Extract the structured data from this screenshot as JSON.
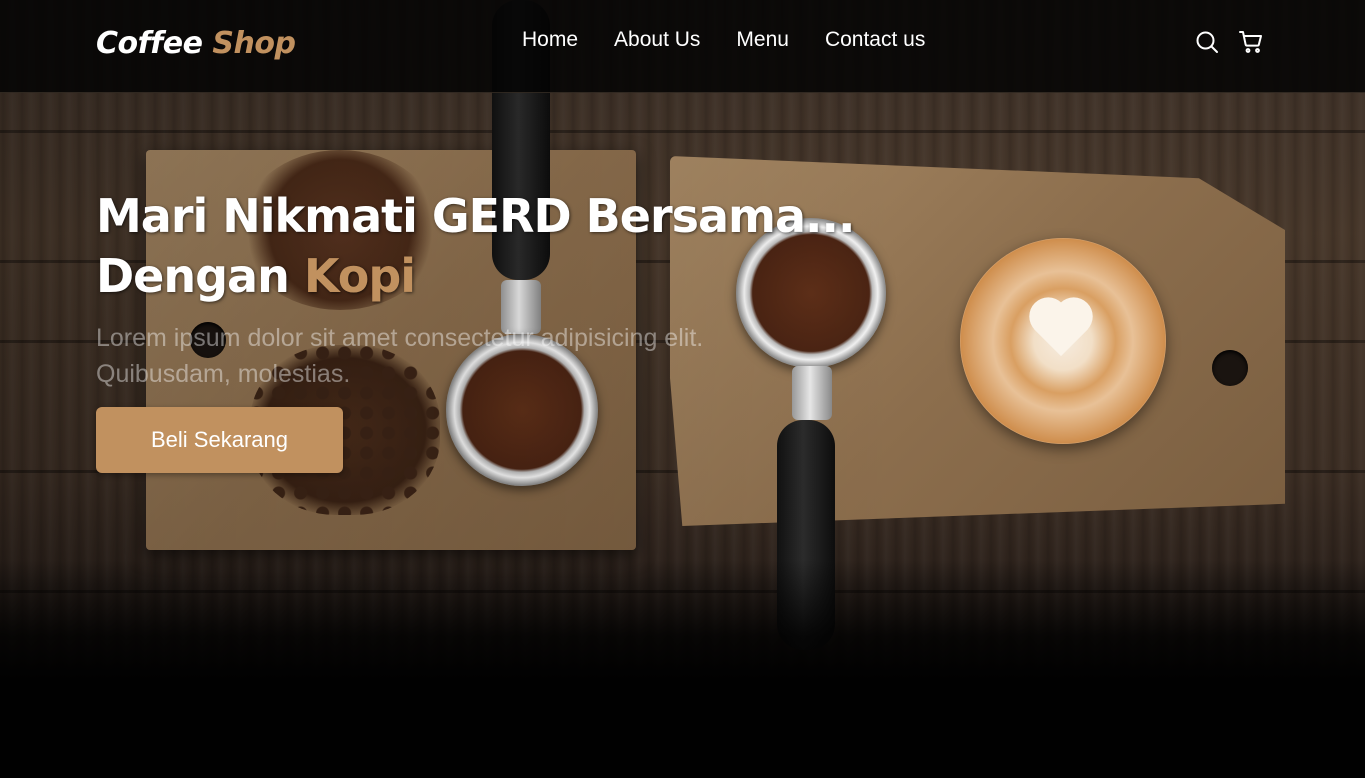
{
  "navbar": {
    "logo": {
      "part1": "Coffee",
      "part2": "Shop"
    },
    "links": [
      {
        "label": "Home"
      },
      {
        "label": "About Us"
      },
      {
        "label": "Menu"
      },
      {
        "label": "Contact us"
      }
    ],
    "icons": [
      "search-icon",
      "cart-icon"
    ]
  },
  "hero": {
    "title_line1": "Mari Nikmati GERD Bersama...",
    "title_line2_prefix": "Dengan",
    "title_line2_accent": "Kopi",
    "description_line1": "Lorem ipsum dolor sit amet consectetur adipisicing elit.",
    "description_line2": "Quibusdam, molestias.",
    "cta_label": "Beli Sekarang"
  },
  "colors": {
    "accent": "#c1915f",
    "navbar_bg": "#040303",
    "page_bg": "#010101",
    "text": "#ffffff"
  }
}
